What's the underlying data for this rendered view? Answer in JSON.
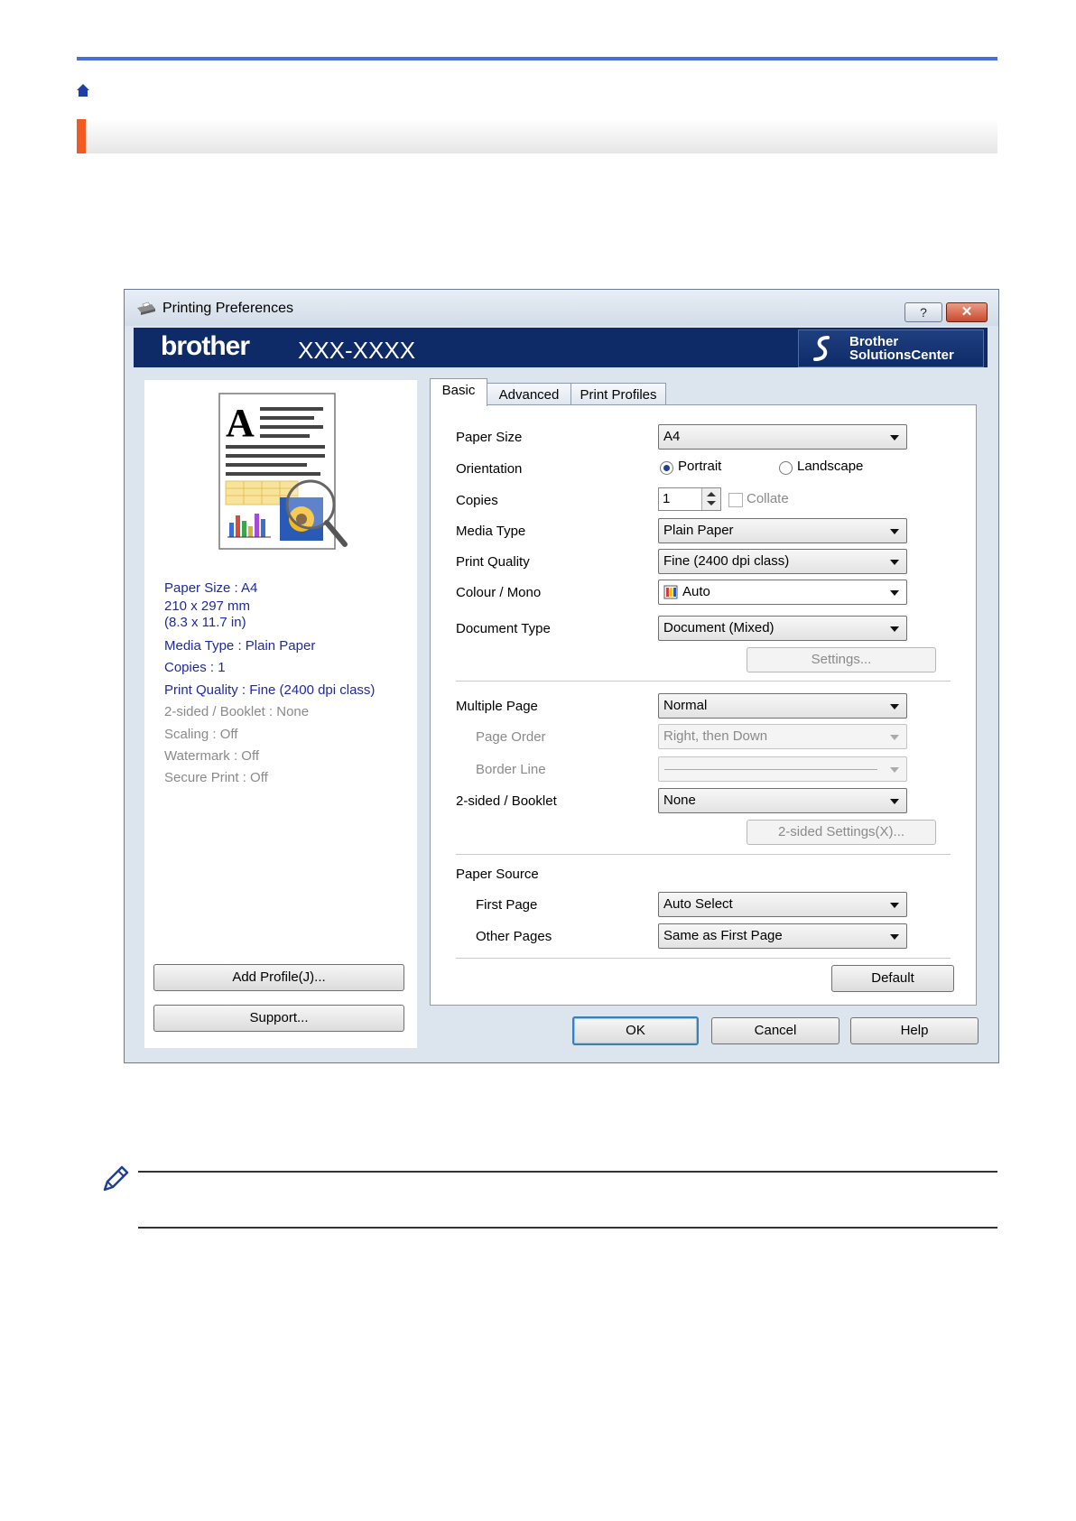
{
  "page": {
    "home_icon": "home-icon",
    "note_icon": "pencil-icon"
  },
  "dialog": {
    "title": "Printing Preferences",
    "help_label": "?",
    "close_label": "✕",
    "brand": "brother",
    "model": "XXX-XXXX",
    "solutions_center": [
      "Brother",
      "SolutionsCenter"
    ],
    "summary": {
      "paper_size": "Paper Size : A4",
      "dimensions_mm": "210 x 297 mm",
      "dimensions_in": "(8.3 x 11.7 in)",
      "media_type": "Media Type : Plain Paper",
      "copies": "Copies : 1",
      "print_quality": "Print Quality : Fine (2400 dpi class)",
      "two_sided": "2-sided / Booklet : None",
      "scaling": "Scaling : Off",
      "watermark": "Watermark : Off",
      "secure_print": "Secure Print : Off"
    },
    "add_profile": "Add Profile(J)...",
    "support": "Support...",
    "tabs": [
      "Basic",
      "Advanced",
      "Print Profiles"
    ],
    "basic": {
      "paper_size": {
        "label": "Paper Size",
        "value": "A4"
      },
      "orientation": {
        "label": "Orientation",
        "portrait": "Portrait",
        "landscape": "Landscape",
        "selected": "Portrait"
      },
      "copies": {
        "label": "Copies",
        "value": "1",
        "collate": "Collate"
      },
      "media_type": {
        "label": "Media Type",
        "value": "Plain Paper"
      },
      "print_quality": {
        "label": "Print Quality",
        "value": "Fine (2400 dpi class)"
      },
      "colour_mono": {
        "label": "Colour / Mono",
        "value": "Auto"
      },
      "document_type": {
        "label": "Document Type",
        "value": "Document (Mixed)"
      },
      "settings": "Settings...",
      "multiple_page": {
        "label": "Multiple Page",
        "value": "Normal"
      },
      "page_order": {
        "label": "Page Order",
        "value": "Right, then Down"
      },
      "border_line": {
        "label": "Border Line",
        "value": ""
      },
      "two_sided": {
        "label": "2-sided / Booklet",
        "value": "None"
      },
      "two_sided_settings": "2-sided Settings(X)...",
      "paper_source": {
        "label": "Paper Source"
      },
      "first_page": {
        "label": "First Page",
        "value": "Auto Select"
      },
      "other_pages": {
        "label": "Other Pages",
        "value": "Same as First Page"
      },
      "default": "Default"
    },
    "ok": "OK",
    "cancel": "Cancel",
    "help": "Help"
  },
  "colors": {
    "top_rule": "#4a6ed8",
    "section_accent": "#f15a22",
    "banner": "#0e2b68",
    "summary_text": "#1f2a9e"
  }
}
